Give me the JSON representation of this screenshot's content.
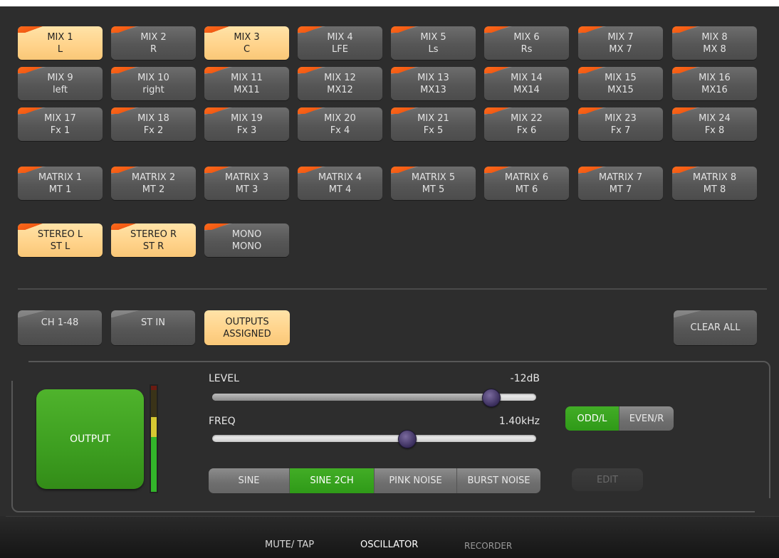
{
  "mix_buttons": [
    {
      "name": "MIX 1",
      "sub": "L",
      "on": true
    },
    {
      "name": "MIX 2",
      "sub": "R",
      "on": false
    },
    {
      "name": "MIX 3",
      "sub": "C",
      "on": true
    },
    {
      "name": "MIX 4",
      "sub": "LFE",
      "on": false
    },
    {
      "name": "MIX 5",
      "sub": "Ls",
      "on": false
    },
    {
      "name": "MIX 6",
      "sub": "Rs",
      "on": false
    },
    {
      "name": "MIX 7",
      "sub": "MX 7",
      "on": false
    },
    {
      "name": "MIX 8",
      "sub": "MX 8",
      "on": false
    },
    {
      "name": "MIX 9",
      "sub": "left",
      "on": false
    },
    {
      "name": "MIX 10",
      "sub": "right",
      "on": false
    },
    {
      "name": "MIX 11",
      "sub": "MX11",
      "on": false
    },
    {
      "name": "MIX 12",
      "sub": "MX12",
      "on": false
    },
    {
      "name": "MIX 13",
      "sub": "MX13",
      "on": false
    },
    {
      "name": "MIX 14",
      "sub": "MX14",
      "on": false
    },
    {
      "name": "MIX 15",
      "sub": "MX15",
      "on": false
    },
    {
      "name": "MIX 16",
      "sub": "MX16",
      "on": false
    },
    {
      "name": "MIX 17",
      "sub": "Fx 1",
      "on": false
    },
    {
      "name": "MIX 18",
      "sub": "Fx 2",
      "on": false
    },
    {
      "name": "MIX 19",
      "sub": "Fx 3",
      "on": false
    },
    {
      "name": "MIX 20",
      "sub": "Fx 4",
      "on": false
    },
    {
      "name": "MIX 21",
      "sub": "Fx 5",
      "on": false
    },
    {
      "name": "MIX 22",
      "sub": "Fx 6",
      "on": false
    },
    {
      "name": "MIX 23",
      "sub": "Fx 7",
      "on": false
    },
    {
      "name": "MIX 24",
      "sub": "Fx 8",
      "on": false
    }
  ],
  "matrix_buttons": [
    {
      "name": "MATRIX 1",
      "sub": "MT 1",
      "on": false
    },
    {
      "name": "MATRIX 2",
      "sub": "MT 2",
      "on": false
    },
    {
      "name": "MATRIX 3",
      "sub": "MT 3",
      "on": false
    },
    {
      "name": "MATRIX 4",
      "sub": "MT 4",
      "on": false
    },
    {
      "name": "MATRIX 5",
      "sub": "MT 5",
      "on": false
    },
    {
      "name": "MATRIX 6",
      "sub": "MT 6",
      "on": false
    },
    {
      "name": "MATRIX 7",
      "sub": "MT 7",
      "on": false
    },
    {
      "name": "MATRIX 8",
      "sub": "MT 8",
      "on": false
    }
  ],
  "stereo_buttons": [
    {
      "name": "STEREO L",
      "sub": "ST L",
      "on": true
    },
    {
      "name": "STEREO R",
      "sub": "ST R",
      "on": true
    },
    {
      "name": "MONO",
      "sub": "MONO",
      "on": false
    }
  ],
  "filter_buttons": {
    "ch": {
      "label": "CH 1-48",
      "on": false
    },
    "stin": {
      "label": "ST IN",
      "on": false
    },
    "outputs": {
      "line1": "OUTPUTS",
      "line2": "ASSIGNED",
      "on": true
    },
    "clear_all": "CLEAR ALL"
  },
  "oscillator": {
    "output_label": "OUTPUT",
    "level_label": "LEVEL",
    "level_value": "-12dB",
    "level_fraction": 0.86,
    "freq_label": "FREQ",
    "freq_value": "1.40kHz",
    "freq_fraction": 0.6,
    "meter_level": 0.7,
    "channel_select": [
      {
        "label": "ODD/L",
        "on": true
      },
      {
        "label": "EVEN/R",
        "on": false
      }
    ],
    "waveforms": [
      {
        "label": "SINE",
        "on": false
      },
      {
        "label": "SINE 2CH",
        "on": true
      },
      {
        "label": "PINK NOISE",
        "on": false
      },
      {
        "label": "BURST NOISE",
        "on": false
      }
    ],
    "edit_label": "EDIT"
  },
  "footer_tabs": {
    "mute_tap": "MUTE/ TAP",
    "oscillator": "OSCILLATOR",
    "recorder": "RECORDER"
  },
  "colors": {
    "accent_on": "#ffd289",
    "active_green": "#3d9e20",
    "corner_marker": "#f15a14"
  }
}
